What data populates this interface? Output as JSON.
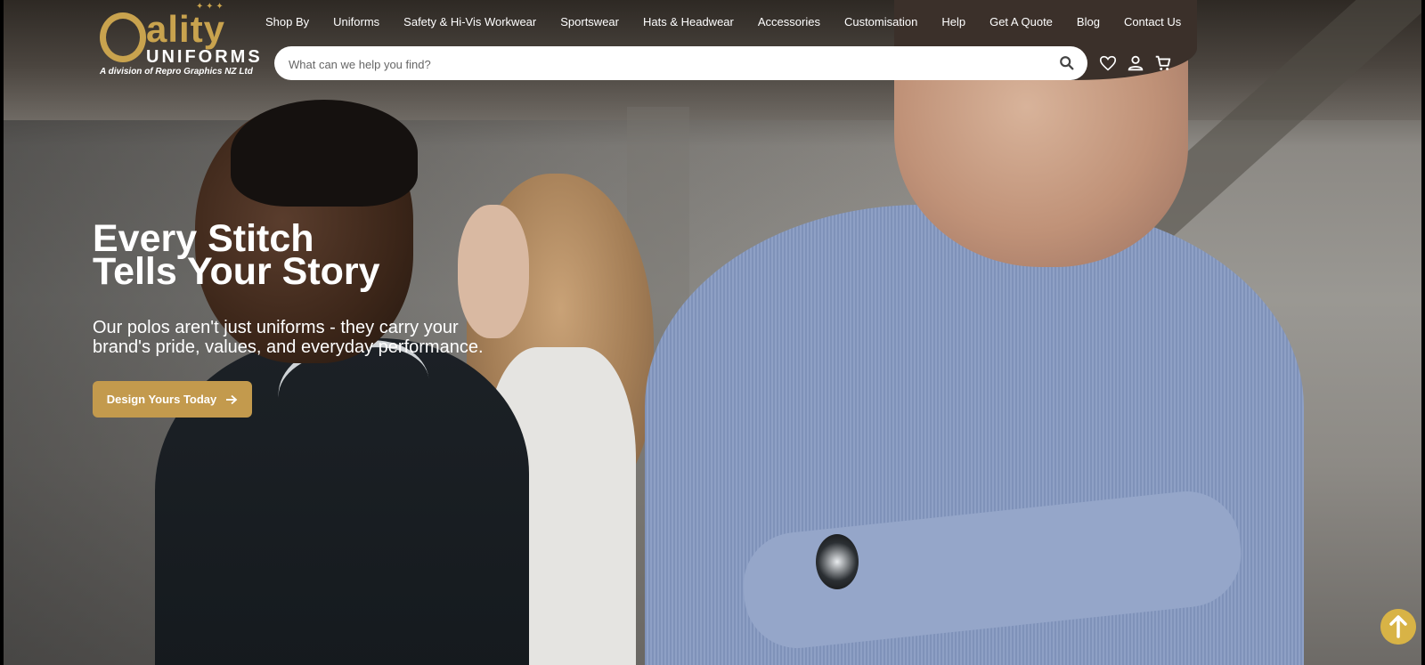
{
  "brand": {
    "logo_word": "ality",
    "logo_sub": "UNIFORMS",
    "logo_division": "A division of Repro Graphics NZ Ltd",
    "accent_color": "#c9a34e"
  },
  "nav": {
    "items": [
      {
        "label": "Shop By"
      },
      {
        "label": "Uniforms"
      },
      {
        "label": "Safety & Hi-Vis Workwear"
      },
      {
        "label": "Sportswear"
      },
      {
        "label": "Hats & Headwear"
      },
      {
        "label": "Accessories"
      },
      {
        "label": "Customisation"
      },
      {
        "label": "Help"
      },
      {
        "label": "Get A Quote"
      },
      {
        "label": "Blog"
      },
      {
        "label": "Contact Us"
      }
    ]
  },
  "search": {
    "placeholder": "What can we help you find?",
    "value": "",
    "icon": "search-icon"
  },
  "header_icons": [
    "heart-icon",
    "user-icon",
    "cart-icon"
  ],
  "hero": {
    "headline_line1": "Every Stitch",
    "headline_line2": "Tells Your Story",
    "subtext": "Our polos aren't just uniforms - they carry your brand's pride, values, and everyday performance.",
    "cta_label": "Design Yours Today",
    "cta_color": "#c39a4d"
  },
  "scroll_top": {
    "icon": "arrow-up-icon",
    "color": "#d8b346"
  }
}
